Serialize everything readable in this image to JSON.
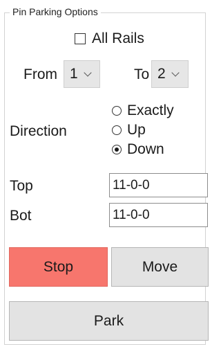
{
  "group": {
    "title": "Pin Parking Options"
  },
  "all_rails": {
    "label": "All Rails",
    "checked": false
  },
  "range": {
    "from_label": "From",
    "from_value": "1",
    "to_label": "To",
    "to_value": "2"
  },
  "direction": {
    "label": "Direction",
    "options": [
      {
        "label": "Exactly",
        "selected": false
      },
      {
        "label": "Up",
        "selected": false
      },
      {
        "label": "Down",
        "selected": true
      }
    ]
  },
  "top": {
    "label": "Top",
    "value": "11-0-0"
  },
  "bot": {
    "label": "Bot",
    "value": "11-0-0"
  },
  "buttons": {
    "stop_label": "Stop",
    "move_label": "Move",
    "park_label": "Park"
  },
  "colors": {
    "stop_button": "#f7766d",
    "button_face": "#e3e3e3"
  }
}
